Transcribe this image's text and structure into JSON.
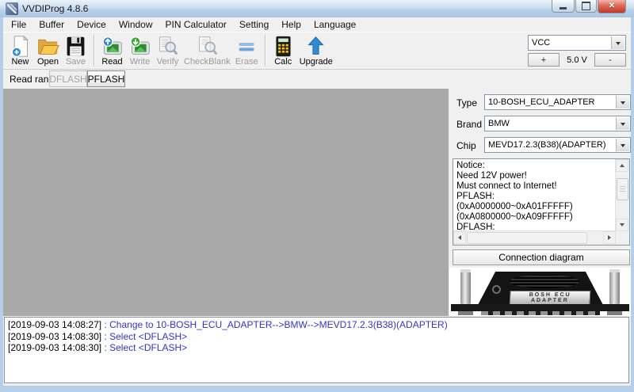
{
  "window": {
    "title": "VVDIProg 4.8.6"
  },
  "menu": {
    "items": [
      "File",
      "Buffer",
      "Device",
      "Window",
      "PIN Calculator",
      "Setting",
      "Help",
      "Language"
    ]
  },
  "toolbar": {
    "buttons": [
      {
        "label": "New",
        "icon": "new-file-icon",
        "enabled": true,
        "sep_after": false
      },
      {
        "label": "Open",
        "icon": "open-folder-icon",
        "enabled": true,
        "sep_after": false
      },
      {
        "label": "Save",
        "icon": "save-icon",
        "enabled": false,
        "sep_after": true
      },
      {
        "label": "Read",
        "icon": "read-chip-icon",
        "enabled": true,
        "sep_after": false
      },
      {
        "label": "Write",
        "icon": "write-chip-icon",
        "enabled": false,
        "sep_after": false
      },
      {
        "label": "Verify",
        "icon": "verify-icon",
        "enabled": false,
        "sep_after": false
      },
      {
        "label": "CheckBlank",
        "icon": "checkblank-icon",
        "enabled": false,
        "sep_after": false
      },
      {
        "label": "Erase",
        "icon": "erase-icon",
        "enabled": false,
        "sep_after": true
      },
      {
        "label": "Calc",
        "icon": "calculator-icon",
        "enabled": true,
        "sep_after": false
      },
      {
        "label": "Upgrade",
        "icon": "upgrade-icon",
        "enabled": true,
        "sep_after": false
      }
    ],
    "voltage": {
      "selector": "VCC",
      "plus": "+",
      "display": "5.0 V",
      "minus": "-"
    }
  },
  "read_range": {
    "label": "Read range",
    "tabs": [
      {
        "label": "DFLASH",
        "enabled": false
      },
      {
        "label": "PFLASH",
        "enabled": true
      }
    ]
  },
  "panel": {
    "fields": [
      {
        "label": "Type",
        "value": "10-BOSH_ECU_ADAPTER"
      },
      {
        "label": "Brand",
        "value": "BMW"
      },
      {
        "label": "Chip",
        "value": "MEVD17.2.3(B38)(ADAPTER)"
      }
    ],
    "notice_lines": [
      "Notice:",
      "Need 12V power!",
      "Must connect to Internet!",
      "PFLASH:",
      "(0xA0000000~0xA01FFFFF)",
      "(0xA0800000~0xA09FFFFF)",
      "DFLASH:"
    ],
    "connection_button": "Connection diagram",
    "adapter": {
      "line1": "BOSH ECU",
      "line2": "ADAPTER"
    }
  },
  "log": {
    "separator": " : ",
    "entries": [
      {
        "timestamp": "[2019-09-03 14:08:27]",
        "message": "Change to 10-BOSH_ECU_ADAPTER-->BMW-->MEVD17.2.3(B38)(ADAPTER)"
      },
      {
        "timestamp": "[2019-09-03 14:08:30]",
        "message": "Select <DFLASH>"
      },
      {
        "timestamp": "[2019-09-03 14:08:30]",
        "message": "Select <DFLASH>"
      }
    ]
  },
  "colors": {
    "title_bar": "#bed5eb",
    "main_area": "#a9a9a9",
    "log_message_blue": "#3333cc",
    "accent_blue": "#2f8ad3",
    "close_button_red": "#c03b28"
  }
}
